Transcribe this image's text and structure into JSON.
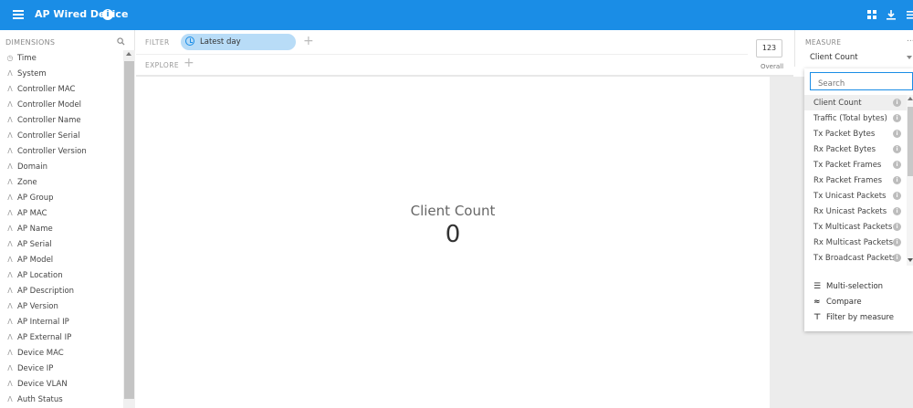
{
  "app": {
    "title": "AP Wired Device"
  },
  "dimensions": {
    "header": "DIMENSIONS",
    "items": [
      {
        "icon": "clock",
        "label": "Time"
      },
      {
        "icon": "A",
        "label": "System"
      },
      {
        "icon": "A",
        "label": "Controller MAC"
      },
      {
        "icon": "A",
        "label": "Controller Model"
      },
      {
        "icon": "A",
        "label": "Controller Name"
      },
      {
        "icon": "A",
        "label": "Controller Serial"
      },
      {
        "icon": "A",
        "label": "Controller Version"
      },
      {
        "icon": "A",
        "label": "Domain"
      },
      {
        "icon": "A",
        "label": "Zone"
      },
      {
        "icon": "A",
        "label": "AP Group"
      },
      {
        "icon": "A",
        "label": "AP MAC"
      },
      {
        "icon": "A",
        "label": "AP Name"
      },
      {
        "icon": "A",
        "label": "AP Serial"
      },
      {
        "icon": "A",
        "label": "AP Model"
      },
      {
        "icon": "A",
        "label": "AP Location"
      },
      {
        "icon": "A",
        "label": "AP Description"
      },
      {
        "icon": "A",
        "label": "AP Version"
      },
      {
        "icon": "A",
        "label": "AP Internal IP"
      },
      {
        "icon": "A",
        "label": "AP External IP"
      },
      {
        "icon": "A",
        "label": "Device MAC"
      },
      {
        "icon": "A",
        "label": "Device IP"
      },
      {
        "icon": "A",
        "label": "Device VLAN"
      },
      {
        "icon": "A",
        "label": "Auth Status"
      }
    ]
  },
  "filter": {
    "label": "FILTER",
    "chip": "Latest day"
  },
  "explore": {
    "label": "EXPLORE"
  },
  "overall": {
    "value": "123",
    "label": "Overall"
  },
  "main": {
    "measure_title": "Client Count",
    "measure_value": "0"
  },
  "measure": {
    "label": "MEASURE",
    "more": "...",
    "selected": "Client Count",
    "search_placeholder": "Search",
    "options": [
      "Client Count",
      "Traffic (Total bytes)",
      "Tx Packet Bytes",
      "Rx Packet Bytes",
      "Tx Packet Frames",
      "Rx Packet Frames",
      "Tx Unicast Packets",
      "Rx Unicast Packets",
      "Tx Multicast Packets",
      "Rx Multicast Packets",
      "Tx Broadcast Packets"
    ],
    "actions": [
      {
        "glyph": "☰",
        "label": "Multi-selection"
      },
      {
        "glyph": "≈",
        "label": "Compare"
      },
      {
        "glyph": "⊤",
        "label": "Filter by measure"
      }
    ]
  },
  "colors": {
    "accent": "#1a8de6",
    "chip": "#b8dcf7"
  }
}
